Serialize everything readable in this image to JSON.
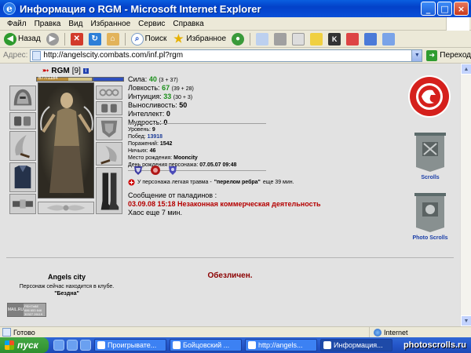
{
  "window": {
    "title": "Информация о RGM - Microsoft Internet Explorer",
    "buttons": [
      "_",
      "□",
      "×"
    ]
  },
  "menu": [
    "Файл",
    "Правка",
    "Вид",
    "Избранное",
    "Сервис",
    "Справка"
  ],
  "toolbar": {
    "back_label": "Назад",
    "search_label": "Поиск",
    "favorites_label": "Избранное"
  },
  "address": {
    "label": "Адрес:",
    "url": "http://angelscity.combats.com/inf.pl?rgm",
    "go_label": "Переход"
  },
  "character": {
    "name": "RGM",
    "level": "[9]",
    "hp_text": "677/1184",
    "hp_fraction": 0.57,
    "stats": [
      {
        "label": "Сила:",
        "value": "40",
        "bonus": "(3 + 37)",
        "color": "green"
      },
      {
        "label": "Ловкость:",
        "value": "67",
        "bonus": "(39 + 28)",
        "color": "green"
      },
      {
        "label": "Интуиция:",
        "value": "33",
        "bonus": "(30 + 3)",
        "color": "green"
      },
      {
        "label": "Выносливость:",
        "value": "50",
        "bonus": "",
        "color": "black"
      },
      {
        "label": "Интеллект:",
        "value": "0",
        "bonus": "",
        "color": "black"
      },
      {
        "label": "Мудрость:",
        "value": "0",
        "bonus": "",
        "color": "black"
      }
    ],
    "info": [
      {
        "label": "Уровень:",
        "value": "9"
      },
      {
        "label": "Побед:",
        "value": "13918"
      },
      {
        "label": "Поражений:",
        "value": "1542"
      },
      {
        "label": "Ничьих:",
        "value": "46"
      },
      {
        "label": "Место рождения:",
        "value": "Mooncity"
      },
      {
        "label": "День рождения персонажа:",
        "value": "07.05.07 09:48"
      }
    ],
    "city": "Angels city",
    "club_text": "Персонаж сейчас находится в клубе.",
    "club_room": "\"Бездна\"",
    "trauma_prefix": "У персонажа легкая травма -",
    "trauma_name": "\"перелом ребра\"",
    "trauma_suffix": "еще 39 мин.",
    "paladin_title": "Сообщение от паладинов :",
    "paladin_message": "03.09.08 15:18 Незаконная коммерческая деятельность",
    "chaos_text": "Хаос еще 7 мин."
  },
  "sidebar": {
    "scrolls_label": "Scrolls",
    "photo_scrolls_label": "Photo Scrolls"
  },
  "blocked_text": "Обезличен.",
  "counter": {
    "line1": "PEHTbBE",
    "line2": "686 653 646",
    "line3": "MAIL.RU",
    "line4": "30327 26119"
  },
  "status": {
    "left": "Готово",
    "zone": "Internet"
  },
  "taskbar": {
    "start": "пуск",
    "tasks": [
      "Проигрывате...",
      "Бойцовский ...",
      "http://angels...",
      "Информация..."
    ],
    "watermark": "photoscrolls.ru"
  }
}
